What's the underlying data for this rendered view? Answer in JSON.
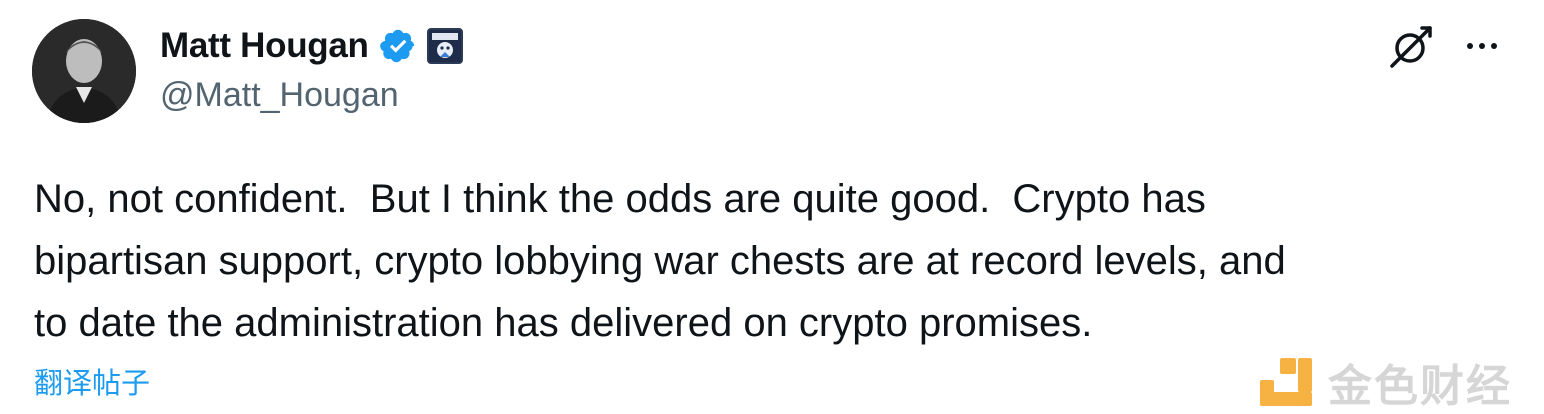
{
  "author": {
    "display_name": "Matt Hougan",
    "handle": "@Matt_Hougan",
    "verified": true,
    "affiliate_badge": "Bitwise"
  },
  "tweet": {
    "text": "No, not confident.  But I think the odds are quite good.  Crypto has\nbipartisan support, crypto lobbying war chests are at record levels, and\nto date the administration has delivered on crypto promises."
  },
  "actions": {
    "translate_label": "翻译帖子"
  },
  "watermark": {
    "text": "金色财经"
  },
  "icons": {
    "grok": "grok-icon",
    "more": "more-icon",
    "verified": "verified-badge-icon"
  },
  "colors": {
    "accent": "#1d9bf0",
    "text_primary": "#0f1419",
    "text_secondary": "#536471",
    "watermark_orange": "#f5a623"
  }
}
